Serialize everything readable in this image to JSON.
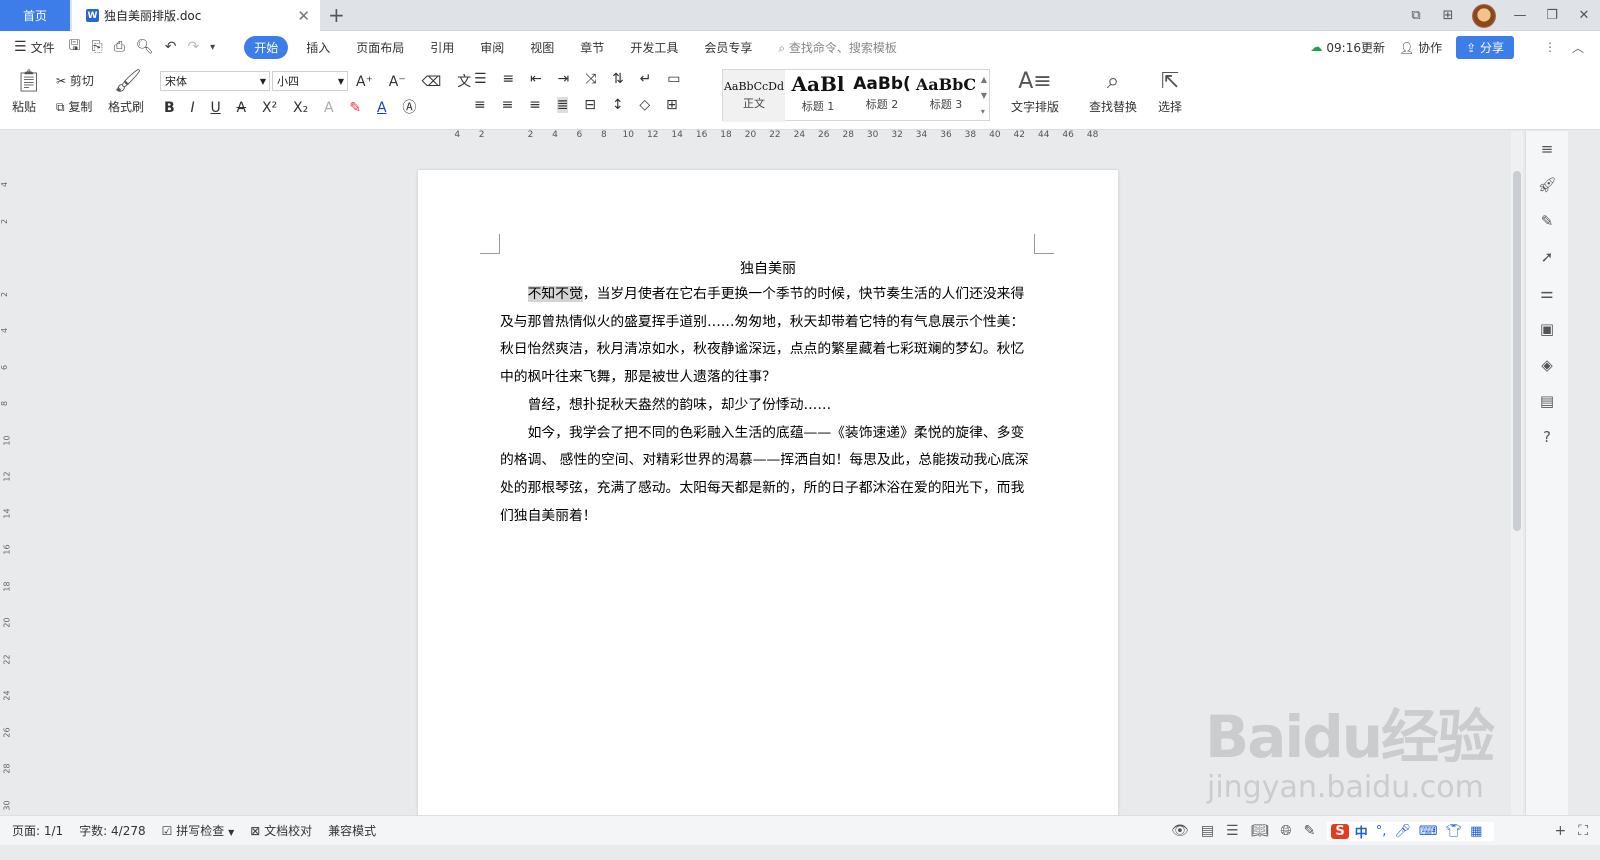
{
  "tabs": {
    "home": "首页",
    "doc_name": "独自美丽排版.doc"
  },
  "menu": {
    "file": "文件",
    "items": [
      "开始",
      "插入",
      "页面布局",
      "引用",
      "审阅",
      "视图",
      "章节",
      "开发工具",
      "会员专享"
    ],
    "search_placeholder": "查找命令、搜索模板",
    "sync_time": "09:16更新",
    "collab": "协作",
    "share": "分享"
  },
  "ribbon": {
    "paste": "粘贴",
    "cut": "剪切",
    "copy": "复制",
    "format_painter": "格式刷",
    "font_name": "宋体",
    "font_size": "小四",
    "styles": [
      {
        "sample": "AaBbCcDd",
        "label": "正文"
      },
      {
        "sample": "AaBl",
        "label": "标题 1"
      },
      {
        "sample": "AaBb(",
        "label": "标题 2"
      },
      {
        "sample": "AaBbC",
        "label": "标题 3"
      }
    ],
    "text_layout": "文字排版",
    "find_replace": "查找替换",
    "select": "选择"
  },
  "ruler": {
    "ticks": [
      "4",
      "2",
      "",
      "2",
      "4",
      "6",
      "8",
      "10",
      "12",
      "14",
      "16",
      "18",
      "20",
      "22",
      "24",
      "26",
      "28",
      "30",
      "32",
      "34",
      "36",
      "38",
      "40",
      "42",
      "44",
      "46",
      "48"
    ],
    "vticks": [
      "4",
      "2",
      "",
      "2",
      "4",
      "6",
      "8",
      "10",
      "12",
      "14",
      "16",
      "18",
      "20",
      "22",
      "24",
      "26",
      "28",
      "30"
    ]
  },
  "document": {
    "title": "独自美丽",
    "highlight": "不知不觉",
    "para1_rest": "，当岁月使者在它右手更换一个季节的时候，快节奏生活的人们还没来得及与那曾热情似火的盛夏挥手道别……匆匆地，秋天却带着它特的有气息展示个性美：秋日怡然爽洁，秋月清凉如水，秋夜静谧深远，点点的繁星藏着七彩斑斓的梦幻。秋忆中的枫叶往来飞舞，那是被世人遗落的往事？",
    "para2": "曾经，想扑捉秋天盎然的韵味，却少了份悸动……",
    "para3": "如今，我学会了把不同的色彩融入生活的底蕴——《装饰速递》柔悦的旋律、多变的格调、 感性的空间、对精彩世界的渴慕——挥洒自如！每思及此，总能拨动我心底深处的那根琴弦，充满了感动。太阳每天都是新的，所的日子都沐浴在爱的阳光下，而我们独自美丽着！"
  },
  "status": {
    "page": "页面: 1/1",
    "words": "字数: 4/278",
    "spell": "拼写检查",
    "proof": "文档校对",
    "compat": "兼容模式",
    "ime_cn": "中"
  },
  "watermark": {
    "logo": "Baidu经验",
    "url": "jingyan.baidu.com"
  }
}
